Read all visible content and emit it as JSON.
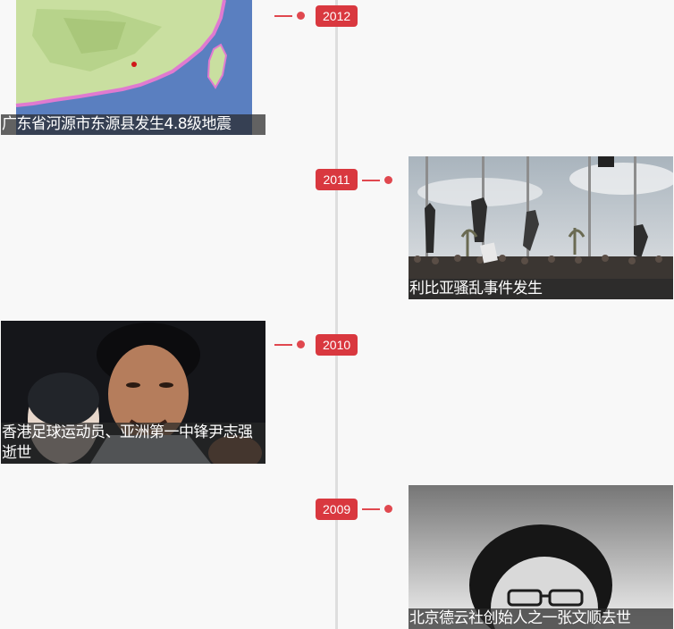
{
  "timeline": {
    "accent_color": "#d9383f",
    "line_color": "#dedede",
    "background": "#f8f8f8",
    "items": [
      {
        "year": "2012",
        "side": "left",
        "image": "earthquake-map-image",
        "caption": "广东省河源市东源县发生4.8级地震"
      },
      {
        "year": "2011",
        "side": "right",
        "image": "protest-crowd-photo",
        "caption": "利比亚骚乱事件发生"
      },
      {
        "year": "2010",
        "side": "left",
        "image": "portrait-photo",
        "caption": "香港足球运动员、亚洲第一中锋尹志强逝世"
      },
      {
        "year": "2009",
        "side": "right",
        "image": "bw-portrait-photo",
        "caption": "北京德云社创始人之一张文顺去世"
      }
    ]
  }
}
